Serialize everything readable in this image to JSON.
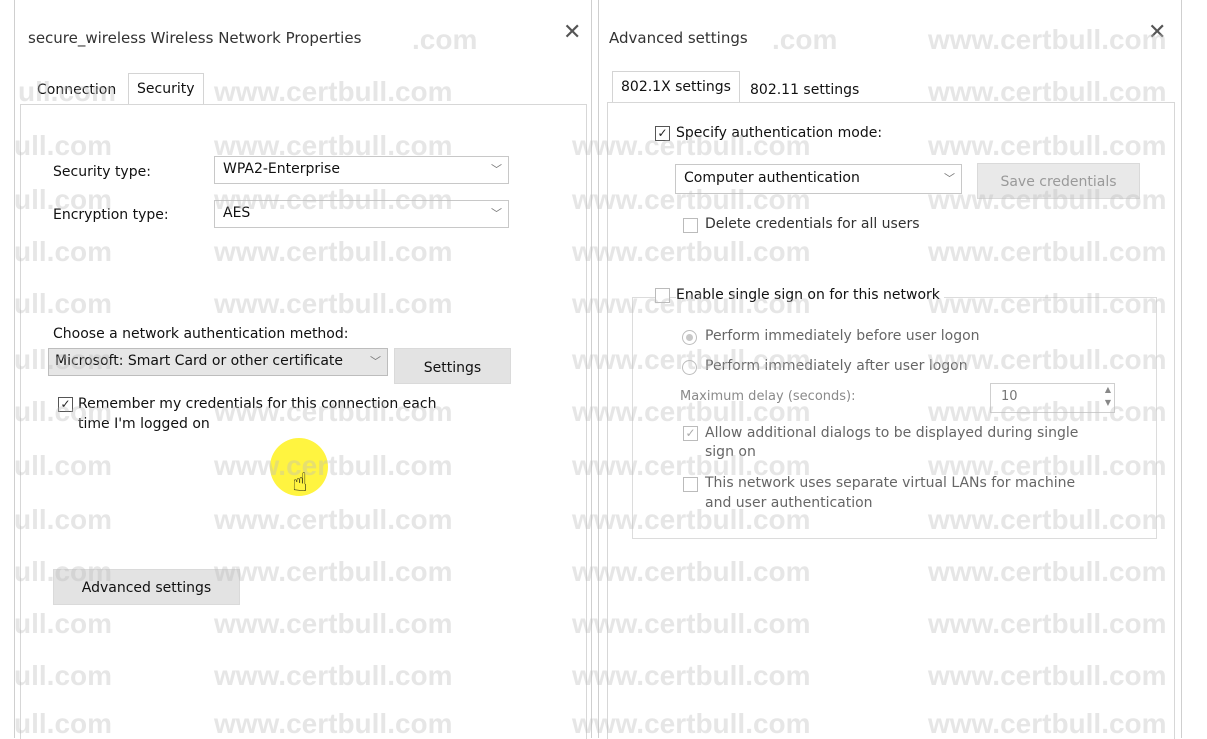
{
  "left_window": {
    "title": "secure_wireless Wireless Network Properties",
    "tabs": [
      {
        "label": "Connection"
      },
      {
        "label": "Security"
      }
    ],
    "security_type": {
      "label": "Security type:",
      "value": "WPA2-Enterprise"
    },
    "encryption_type": {
      "label": "Encryption type:",
      "value": "AES"
    },
    "auth_method": {
      "label": "Choose a network authentication method:",
      "value": "Microsoft: Smart Card or other certificate"
    },
    "settings_label": "Settings",
    "remember_line1": "Remember my credentials for this connection each",
    "remember_line2": "time I'm logged on",
    "advanced_label": "Advanced settings"
  },
  "right_window": {
    "title": "Advanced settings",
    "tabs": [
      {
        "label": "802.1X settings"
      },
      {
        "label": "802.11 settings"
      }
    ],
    "specify_auth": "Specify authentication mode:",
    "auth_mode": "Computer authentication",
    "save_credentials": "Save credentials",
    "delete_credentials": "Delete credentials for all users",
    "enable_sso": "Enable single sign on for this network",
    "perform_before": "Perform immediately before user logon",
    "perform_after": "Perform immediately after user logon",
    "max_delay_label": "Maximum delay (seconds):",
    "max_delay_value": "10",
    "allow_dialogs_1": "Allow additional dialogs to be displayed during single",
    "allow_dialogs_2": "sign on",
    "vlan_1": "This network uses separate virtual LANs for machine",
    "vlan_2": "and user authentication"
  },
  "icons": {
    "close": "close-icon",
    "chevron": "chevron-down-icon",
    "check": "checkmark-icon",
    "hand_cursor": "hand-pointer-icon"
  },
  "watermark": {
    "text1": "www.certbull.com",
    "text2": "ull.com",
    "text3": ".com"
  }
}
